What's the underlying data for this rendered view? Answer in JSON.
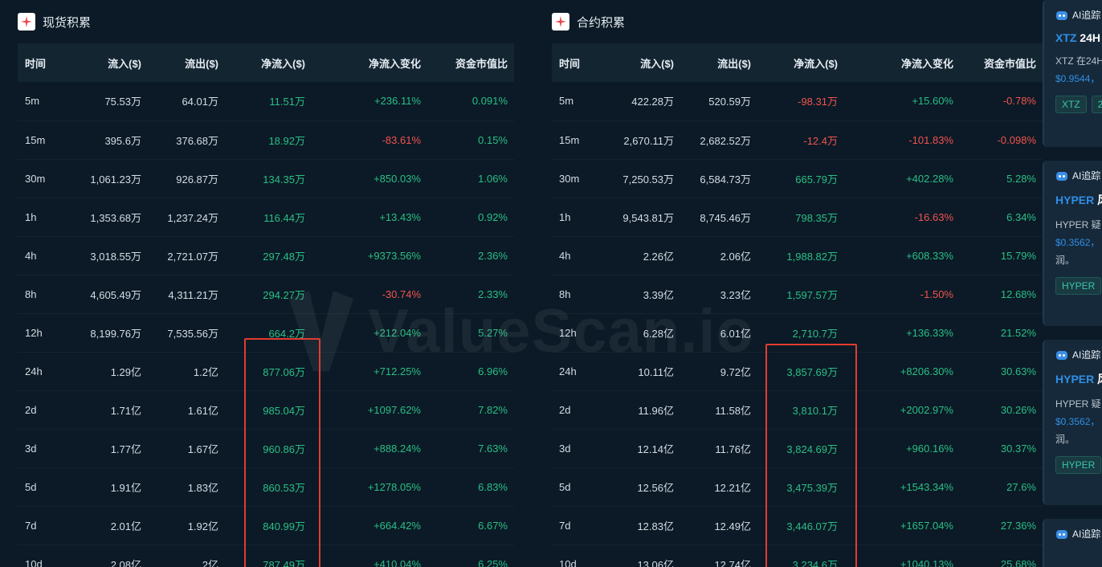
{
  "spot": {
    "title": "现货积累",
    "headers": [
      "时间",
      "流入($)",
      "流出($)",
      "净流入($)",
      "净流入变化",
      "资金市值比"
    ],
    "rows": [
      [
        "5m",
        "75.53万",
        "64.01万",
        "11.51万",
        "+236.11%",
        "0.091%"
      ],
      [
        "15m",
        "395.6万",
        "376.68万",
        "18.92万",
        "-83.61%",
        "0.15%"
      ],
      [
        "30m",
        "1,061.23万",
        "926.87万",
        "134.35万",
        "+850.03%",
        "1.06%"
      ],
      [
        "1h",
        "1,353.68万",
        "1,237.24万",
        "116.44万",
        "+13.43%",
        "0.92%"
      ],
      [
        "4h",
        "3,018.55万",
        "2,721.07万",
        "297.48万",
        "+9373.56%",
        "2.36%"
      ],
      [
        "8h",
        "4,605.49万",
        "4,311.21万",
        "294.27万",
        "-30.74%",
        "2.33%"
      ],
      [
        "12h",
        "8,199.76万",
        "7,535.56万",
        "664.2万",
        "+212.04%",
        "5.27%"
      ],
      [
        "24h",
        "1.29亿",
        "1.2亿",
        "877.06万",
        "+712.25%",
        "6.96%"
      ],
      [
        "2d",
        "1.71亿",
        "1.61亿",
        "985.04万",
        "+1097.62%",
        "7.82%"
      ],
      [
        "3d",
        "1.77亿",
        "1.67亿",
        "960.86万",
        "+888.24%",
        "7.63%"
      ],
      [
        "5d",
        "1.91亿",
        "1.83亿",
        "860.53万",
        "+1278.05%",
        "6.83%"
      ],
      [
        "7d",
        "2.01亿",
        "1.92亿",
        "840.99万",
        "+664.42%",
        "6.67%"
      ],
      [
        "10d",
        "2.08亿",
        "2亿",
        "787.49万",
        "+410.04%",
        "6.25%"
      ]
    ]
  },
  "futures": {
    "title": "合约积累",
    "headers": [
      "时间",
      "流入($)",
      "流出($)",
      "净流入($)",
      "净流入变化",
      "资金市值比"
    ],
    "rows": [
      [
        "5m",
        "422.28万",
        "520.59万",
        "-98.31万",
        "+15.60%",
        "-0.78%"
      ],
      [
        "15m",
        "2,670.11万",
        "2,682.52万",
        "-12.4万",
        "-101.83%",
        "-0.098%"
      ],
      [
        "30m",
        "7,250.53万",
        "6,584.73万",
        "665.79万",
        "+402.28%",
        "5.28%"
      ],
      [
        "1h",
        "9,543.81万",
        "8,745.46万",
        "798.35万",
        "-16.63%",
        "6.34%"
      ],
      [
        "4h",
        "2.26亿",
        "2.06亿",
        "1,988.82万",
        "+608.33%",
        "15.79%"
      ],
      [
        "8h",
        "3.39亿",
        "3.23亿",
        "1,597.57万",
        "-1.50%",
        "12.68%"
      ],
      [
        "12h",
        "6.28亿",
        "6.01亿",
        "2,710.7万",
        "+136.33%",
        "21.52%"
      ],
      [
        "24h",
        "10.11亿",
        "9.72亿",
        "3,857.69万",
        "+8206.30%",
        "30.63%"
      ],
      [
        "2d",
        "11.96亿",
        "11.58亿",
        "3,810.1万",
        "+2002.97%",
        "30.26%"
      ],
      [
        "3d",
        "12.14亿",
        "11.76亿",
        "3,824.69万",
        "+960.16%",
        "30.37%"
      ],
      [
        "5d",
        "12.56亿",
        "12.21亿",
        "3,475.39万",
        "+1543.34%",
        "27.6%"
      ],
      [
        "7d",
        "12.83亿",
        "12.49亿",
        "3,446.07万",
        "+1657.04%",
        "27.36%"
      ],
      [
        "10d",
        "13.06亿",
        "12.74亿",
        "3,234.6万",
        "+1040.13%",
        "25.68%"
      ]
    ]
  },
  "watermark": "ValueScan.io",
  "colors": {
    "positive": "#2bbf86",
    "negative": "#f2534f",
    "highlight": "#e23b30",
    "link": "#2f8fe6"
  },
  "side_cards": [
    {
      "label": "AI追踪",
      "title_accent": "XTZ",
      "title_rest": " 24H",
      "text_lines": [
        "XTZ 在24H"
      ],
      "price": "$0.9544，",
      "chips": [
        "XTZ",
        "2"
      ]
    },
    {
      "label": "AI追踪",
      "title_accent": "HYPER",
      "title_rest": " 风",
      "text_lines": [
        "HYPER 疑"
      ],
      "price": "$0.3562，",
      "extra": "润。",
      "chips": [
        "HYPER"
      ]
    },
    {
      "label": "AI追踪",
      "title_accent": "HYPER",
      "title_rest": " 风",
      "text_lines": [
        "HYPER 疑"
      ],
      "price": "$0.3562，",
      "extra": "润。",
      "chips": [
        "HYPER"
      ]
    },
    {
      "label": "AI追踪"
    }
  ]
}
